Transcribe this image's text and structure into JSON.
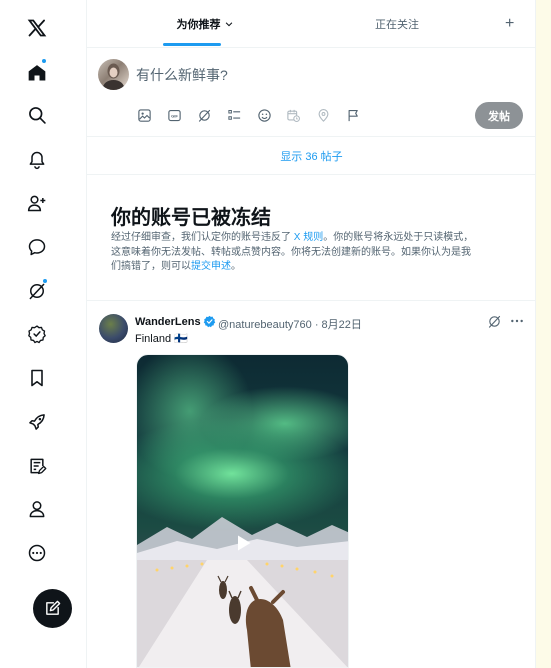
{
  "sidebar": {
    "items": [
      {
        "name": "x-logo",
        "icon": "x-logo-icon"
      },
      {
        "name": "home",
        "icon": "home-icon",
        "notification": true
      },
      {
        "name": "explore",
        "icon": "search-icon"
      },
      {
        "name": "notifications",
        "icon": "bell-icon"
      },
      {
        "name": "follow",
        "icon": "person-add-icon"
      },
      {
        "name": "messages",
        "icon": "chat-bubble-icon"
      },
      {
        "name": "grok",
        "icon": "grok-icon",
        "notification": true
      },
      {
        "name": "verified-orgs",
        "icon": "verified-badge-icon"
      },
      {
        "name": "bookmarks",
        "icon": "bookmark-icon"
      },
      {
        "name": "jobs",
        "icon": "rocket-icon"
      },
      {
        "name": "articles",
        "icon": "edit-document-icon"
      },
      {
        "name": "profile",
        "icon": "person-icon"
      },
      {
        "name": "more",
        "icon": "more-circle-icon"
      }
    ],
    "compose_icon": "compose-icon"
  },
  "tabs": {
    "for_you": "为你推荐",
    "following": "正在关注",
    "add": "+"
  },
  "composer": {
    "placeholder": "有什么新鲜事?",
    "post_button": "发帖",
    "tools": [
      "image-icon",
      "gif-icon",
      "grok-icon",
      "poll-icon",
      "emoji-icon",
      "schedule-icon",
      "location-icon",
      "flag-icon"
    ]
  },
  "show_posts": "显示 36 帖子",
  "frozen_notice": {
    "title": "你的账号已被冻结",
    "line1_prefix": "经过仔细审查，我们认定你的账号违反了 ",
    "line1_link": "X 规则",
    "line1_suffix": "。你的账号将永远处于只读模式，",
    "line2": "这意味着你无法发帖、转帖或点赞内容。你将无法创建新的账号。如果你认为是我",
    "line3_prefix": "们搞错了，则可以",
    "line3_link": "提交申述",
    "line3_suffix": "。"
  },
  "tweet": {
    "name": "WanderLens",
    "handle": "@naturebeauty760",
    "separator": "·",
    "date": "8月22日",
    "text": "Finland 🇫🇮",
    "colors": {
      "accent": "#1d9bf0",
      "text": "#0f1419",
      "muted": "#536471"
    }
  }
}
